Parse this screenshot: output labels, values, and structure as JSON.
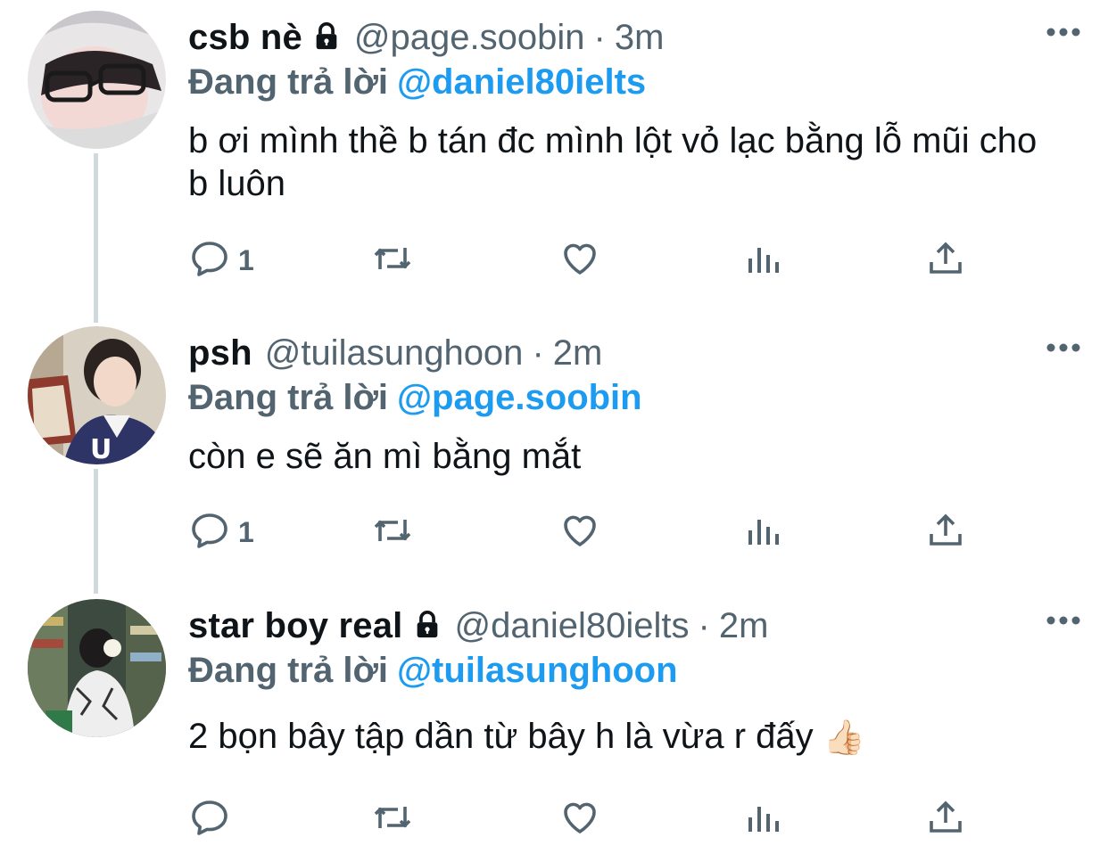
{
  "tweets": [
    {
      "display_name": "csb nè",
      "locked": true,
      "handle": "@page.soobin",
      "separator": "·",
      "time": "3m",
      "replying_label": "Đang trả lời",
      "replying_to": "@daniel80ielts",
      "text": "b ơi mình thề b tán đc mình lột vỏ lạc bằng lỗ mũi cho b luôn",
      "reply_count": "1"
    },
    {
      "display_name": "psh",
      "locked": false,
      "handle": "@tuilasunghoon",
      "separator": "·",
      "time": "2m",
      "replying_label": "Đang trả lời",
      "replying_to": "@page.soobin",
      "text": "còn e sẽ ăn mì bằng mắt",
      "reply_count": "1"
    },
    {
      "display_name": "star boy real",
      "locked": true,
      "handle": "@daniel80ielts",
      "separator": "·",
      "time": "2m",
      "replying_label": "Đang trả lời",
      "replying_to": "@tuilasunghoon",
      "text": "2 bọn bây tập dần từ bây h là vừa r đấy",
      "emoji": "👍🏻",
      "reply_count": ""
    }
  ],
  "colors": {
    "text": "#0f1419",
    "secondary": "#536471",
    "link": "#1d9bf0",
    "thread_line": "#cfd9de"
  },
  "icons": [
    "lock-icon",
    "more-icon",
    "reply-icon",
    "retweet-icon",
    "like-icon",
    "analytics-icon",
    "share-icon"
  ]
}
